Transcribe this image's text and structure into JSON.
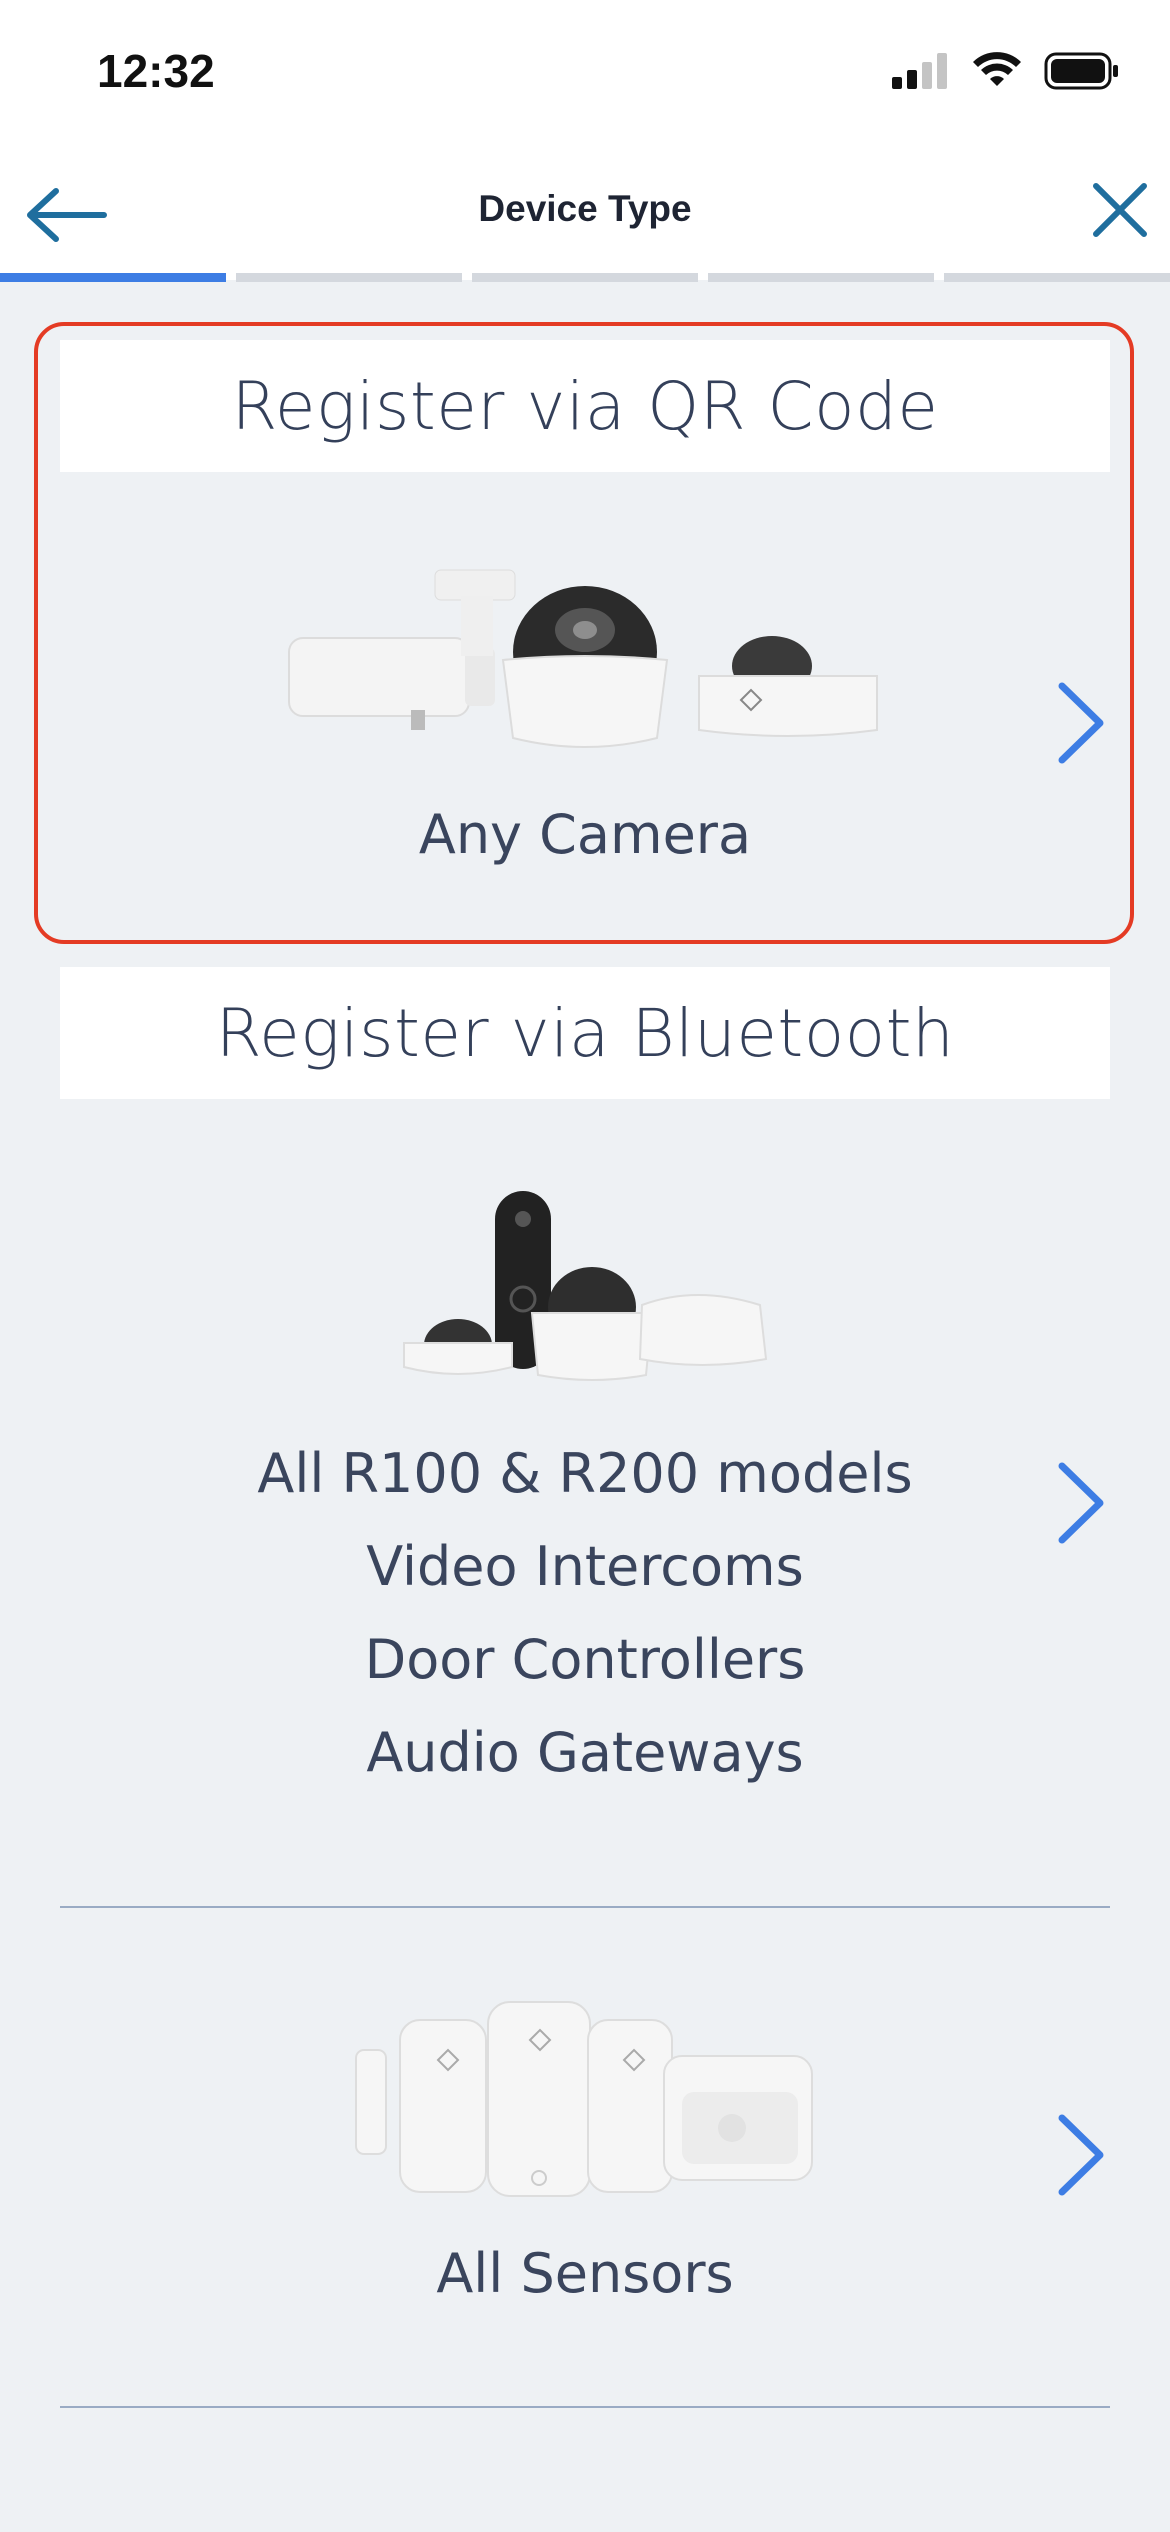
{
  "status_bar": {
    "time": "12:32"
  },
  "nav": {
    "title": "Device Type"
  },
  "progress": {
    "segments": 5,
    "active_index": 0
  },
  "sections": {
    "qr": {
      "header": "Register via QR Code",
      "caption": "Any Camera"
    },
    "bluetooth": {
      "header": "Register via Bluetooth",
      "lines": [
        "All R100 & R200 models",
        "Video Intercoms",
        "Door Controllers",
        "Audio Gateways"
      ]
    },
    "sensors": {
      "caption": "All Sensors"
    }
  },
  "colors": {
    "accent": "#3d7de4",
    "highlight_border": "#e43b24",
    "nav_icon": "#1f6e9e"
  }
}
